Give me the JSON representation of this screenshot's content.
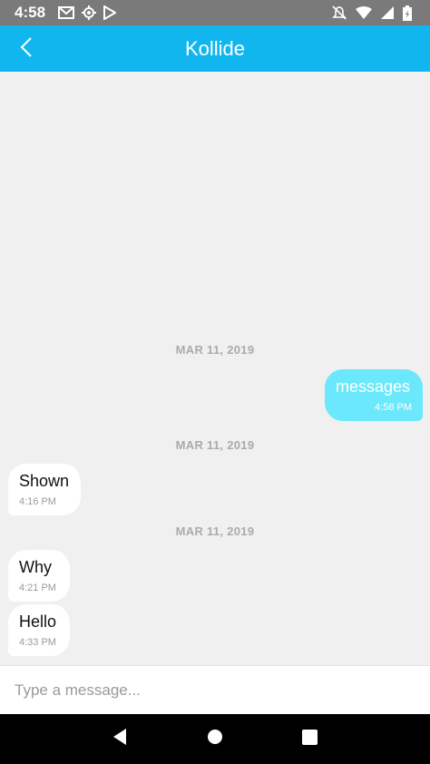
{
  "status_bar": {
    "time": "4:58",
    "left_icons": [
      "gmail-icon",
      "location-target-icon",
      "play-store-icon"
    ],
    "right_icons": [
      "notifications-off-icon",
      "wifi-icon",
      "signal-icon",
      "battery-icon"
    ]
  },
  "app_bar": {
    "title": "Kollide",
    "back_icon": "chevron-left-icon",
    "color": "#12b6ef"
  },
  "messages": [
    {
      "type": "date",
      "text": "MAR 11, 2019"
    },
    {
      "type": "outgoing",
      "text": "messages",
      "time": "4:58 PM"
    },
    {
      "type": "date",
      "text": "MAR 11, 2019"
    },
    {
      "type": "incoming",
      "text": "Shown",
      "time": "4:16 PM"
    },
    {
      "type": "date",
      "text": "MAR 11, 2019"
    },
    {
      "type": "incoming",
      "text": "Why",
      "time": "4:21 PM"
    },
    {
      "type": "incoming",
      "text": "Hello",
      "time": "4:33 PM"
    }
  ],
  "composer": {
    "placeholder": "Type a message...",
    "value": ""
  },
  "nav_bar": {
    "icons": [
      "back-triangle-icon",
      "home-circle-icon",
      "recents-square-icon"
    ]
  },
  "colors": {
    "outgoing_bubble": "#6be8fb",
    "incoming_bubble": "#ffffff",
    "background": "#f0f0f0"
  }
}
